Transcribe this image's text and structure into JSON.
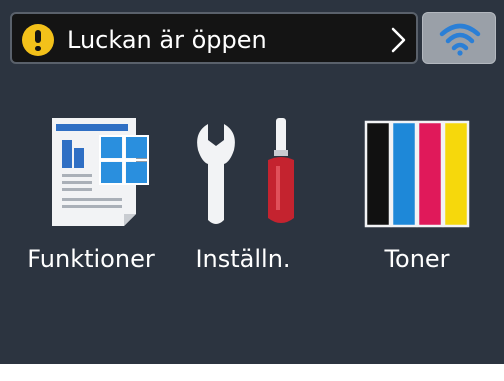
{
  "status_bar": {
    "message": "Luckan är öppen",
    "warning_icon": "warning-icon",
    "chevron_icon": "chevron-right-icon"
  },
  "wifi": {
    "icon": "wifi-icon",
    "color": "#2b7fd6"
  },
  "menu": {
    "items": [
      {
        "label": "Funktioner",
        "icon": "functions-icon"
      },
      {
        "label": "Inställn.",
        "icon": "settings-tools-icon"
      },
      {
        "label": "Toner",
        "icon": "toner-icon"
      }
    ]
  },
  "colors": {
    "background": "#2c3440",
    "warning": "#f3c11a",
    "toner": [
      "#111111",
      "#1e88d8",
      "#e0195a",
      "#f6d80c"
    ]
  }
}
